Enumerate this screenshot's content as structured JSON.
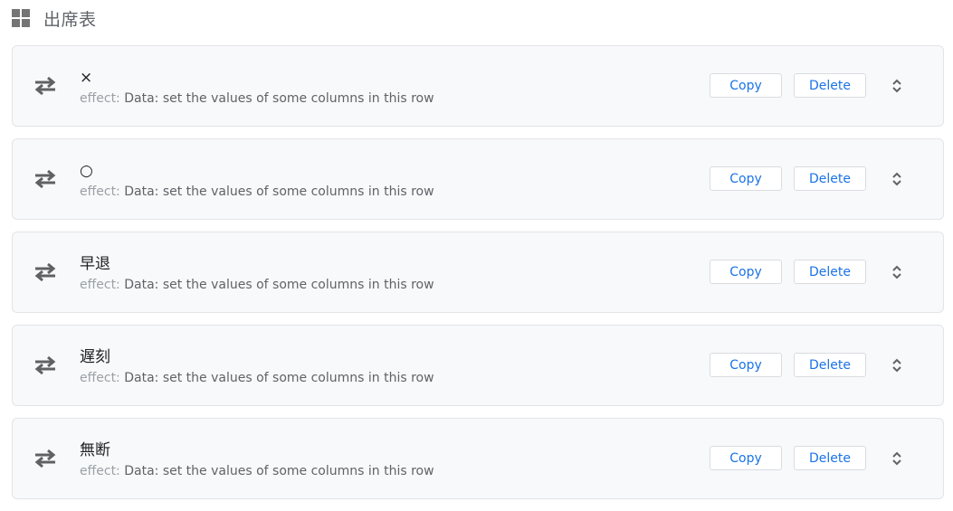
{
  "header": {
    "icon": "grid-view-icon",
    "title": "出席表"
  },
  "actions": [
    {
      "name": "×",
      "effect_label": "effect:",
      "effect_value": "Data: set the values of some columns in this row",
      "copy_label": "Copy",
      "delete_label": "Delete"
    },
    {
      "name": "○",
      "effect_label": "effect:",
      "effect_value": "Data: set the values of some columns in this row",
      "copy_label": "Copy",
      "delete_label": "Delete"
    },
    {
      "name": "早退",
      "effect_label": "effect:",
      "effect_value": "Data: set the values of some columns in this row",
      "copy_label": "Copy",
      "delete_label": "Delete"
    },
    {
      "name": "遅刻",
      "effect_label": "effect:",
      "effect_value": "Data: set the values of some columns in this row",
      "copy_label": "Copy",
      "delete_label": "Delete"
    },
    {
      "name": "無断",
      "effect_label": "effect:",
      "effect_value": "Data: set the values of some columns in this row",
      "copy_label": "Copy",
      "delete_label": "Delete"
    }
  ],
  "colors": {
    "accent": "#1a73e8",
    "card_background": "#f8f9fa",
    "icon": "#616161"
  }
}
